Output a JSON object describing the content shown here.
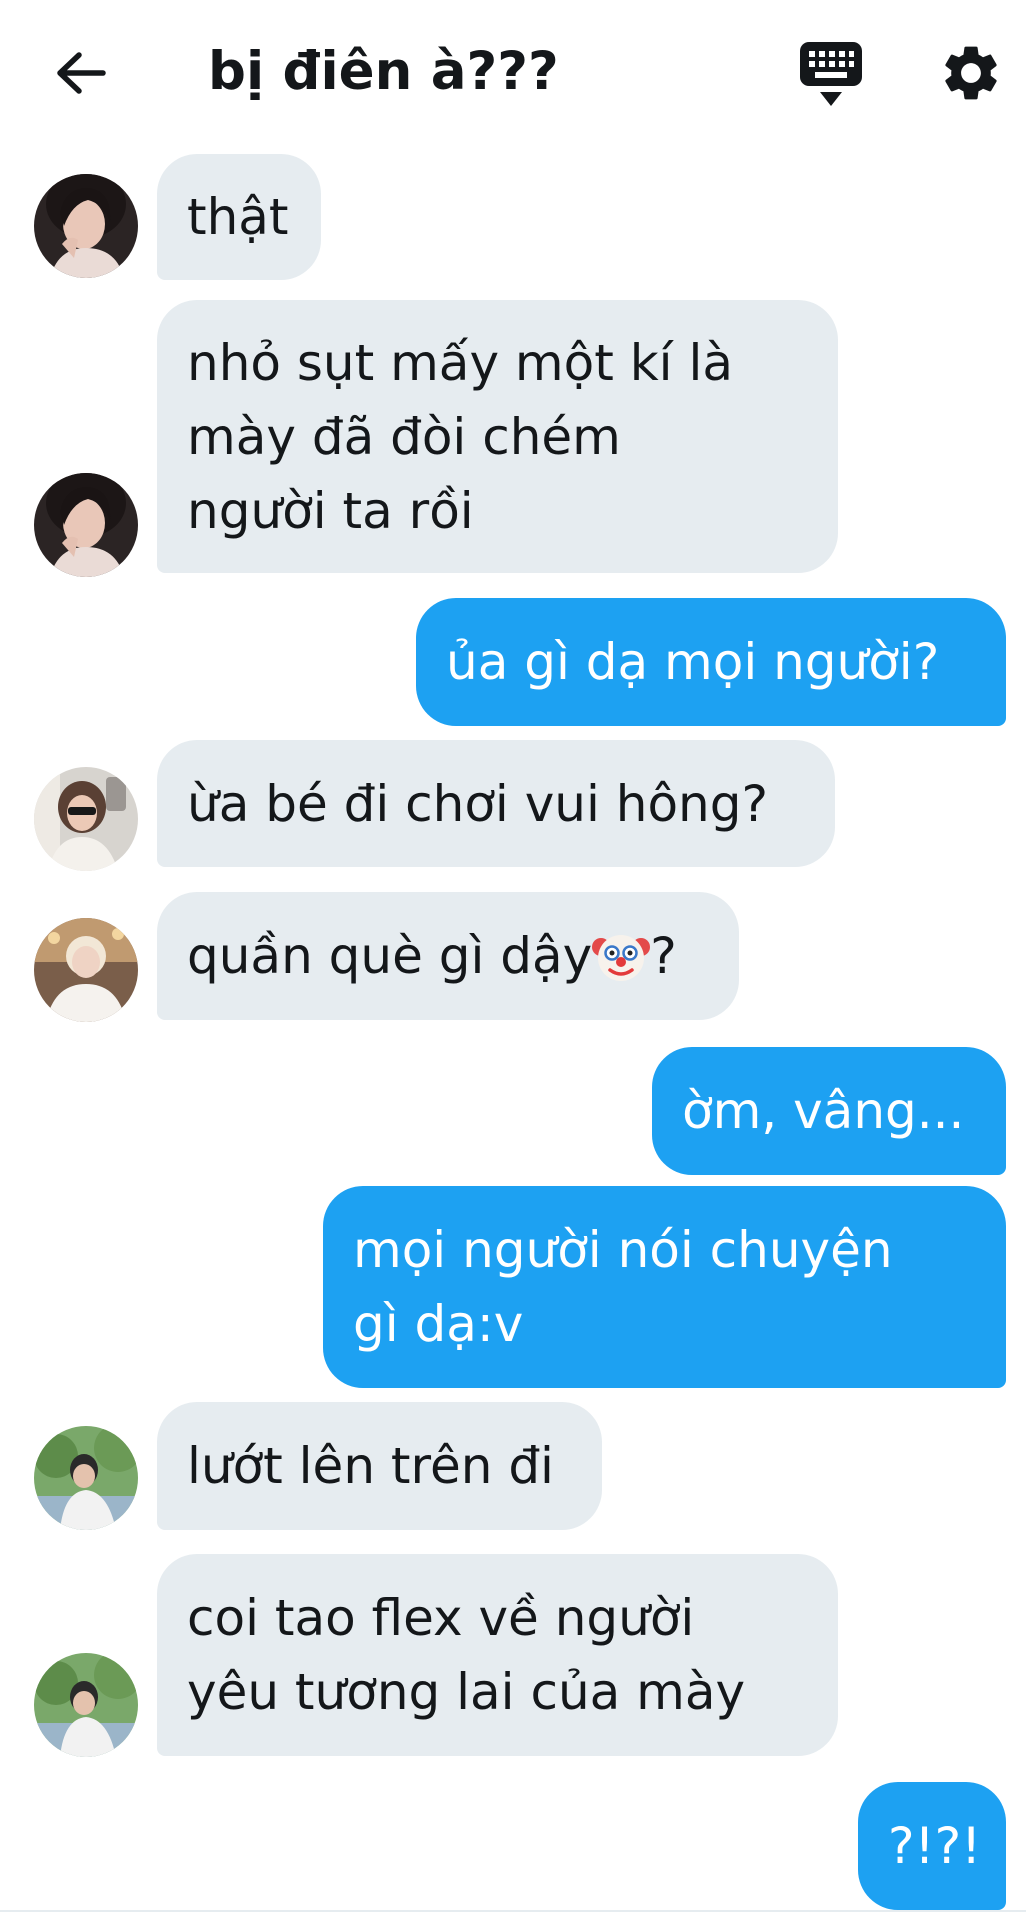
{
  "header": {
    "title": "bị điên à???",
    "back_icon": "arrow-left-icon",
    "keyboard_icon": "keyboard-icon",
    "settings_icon": "gear-icon"
  },
  "colors": {
    "outgoing_bubble": "#1da1f2",
    "incoming_bubble": "#e6ecf0",
    "text": "#14171a"
  },
  "messages": [
    {
      "direction": "incoming",
      "text": "thật"
    },
    {
      "direction": "incoming",
      "text": "nhỏ sụt mấy một kí là\nmày đã đòi chém\nngười ta rồi"
    },
    {
      "direction": "outgoing",
      "text": "ủa gì dạ mọi người?"
    },
    {
      "direction": "incoming",
      "text": "ừa bé đi chơi vui hông?"
    },
    {
      "direction": "incoming",
      "text_before_emoji": "quần què gì dậy",
      "emoji": "clown-face-emoji",
      "text_after_emoji": "?"
    },
    {
      "direction": "outgoing",
      "text": "ờm, vâng..."
    },
    {
      "direction": "outgoing",
      "text": "mọi người nói chuyện\ngì dạ:v"
    },
    {
      "direction": "incoming",
      "text": "lướt lên trên đi"
    },
    {
      "direction": "incoming",
      "text": "coi tao flex về người\nyêu tương lai của mày"
    },
    {
      "direction": "outgoing",
      "text": "?!?!"
    }
  ]
}
